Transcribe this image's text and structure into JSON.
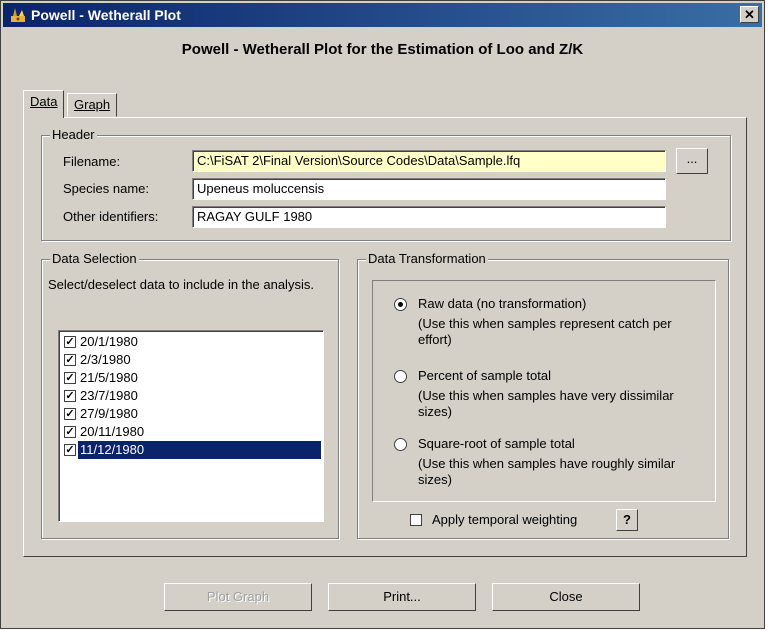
{
  "window": {
    "title": "Powell - Wetherall Plot",
    "close_glyph": "✕"
  },
  "heading": "Powell - Wetherall Plot for the Estimation of Loo and Z/K",
  "tabs": [
    {
      "label": "Data",
      "active": true
    },
    {
      "label": "Graph",
      "active": false
    }
  ],
  "header": {
    "legend": "Header",
    "filename_label": "Filename:",
    "filename_value": "C:\\FiSAT 2\\Final Version\\Source Codes\\Data\\Sample.lfq",
    "browse_label": "...",
    "species_label": "Species name:",
    "species_value": "Upeneus moluccensis",
    "other_label": "Other identifiers:",
    "other_value": "RAGAY GULF 1980"
  },
  "data_selection": {
    "legend": "Data Selection",
    "instructions": "Select/deselect data to include in the analysis.",
    "items": [
      {
        "label": "20/1/1980",
        "checked": true,
        "selected": false
      },
      {
        "label": "2/3/1980",
        "checked": true,
        "selected": false
      },
      {
        "label": "21/5/1980",
        "checked": true,
        "selected": false
      },
      {
        "label": "23/7/1980",
        "checked": true,
        "selected": false
      },
      {
        "label": "27/9/1980",
        "checked": true,
        "selected": false
      },
      {
        "label": "20/11/1980",
        "checked": true,
        "selected": false
      },
      {
        "label": "11/12/1980",
        "checked": true,
        "selected": true
      }
    ]
  },
  "transformation": {
    "legend": "Data Transformation",
    "options": [
      {
        "label": "Raw data (no transformation)",
        "hint": "(Use this when samples represent catch per effort)",
        "selected": true
      },
      {
        "label": "Percent of sample total",
        "hint": "(Use this when samples have very dissimilar sizes)",
        "selected": false
      },
      {
        "label": "Square-root of sample total",
        "hint": "(Use this when samples have roughly similar sizes)",
        "selected": false
      }
    ],
    "temporal_label": "Apply temporal weighting",
    "temporal_checked": false,
    "help_label": "?"
  },
  "buttons": {
    "plot": "Plot Graph",
    "print": "Print...",
    "close": "Close"
  },
  "colors": {
    "title_bar": "#0a246a",
    "face": "#d4d0c8",
    "highlight_field": "#ffffc8",
    "selection": "#0a246a"
  }
}
